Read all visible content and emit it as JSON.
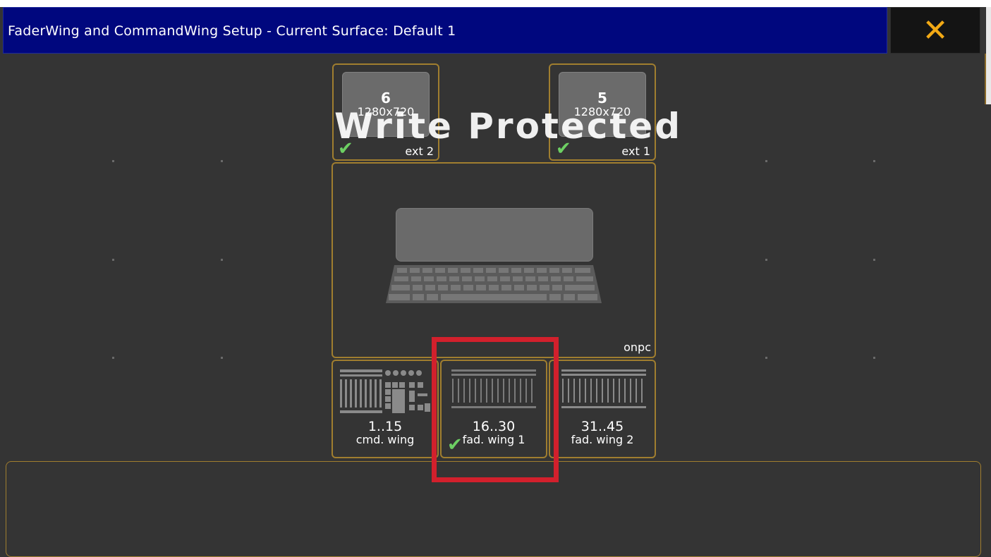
{
  "window": {
    "title": "FaderWing and CommandWing Setup - Current Surface: Default 1",
    "close_glyph": "✕"
  },
  "overlay": {
    "text": "Write Protected"
  },
  "monitors": [
    {
      "number": "6",
      "resolution": "1280x720",
      "name": "ext 2",
      "checked": true
    },
    {
      "number": "5",
      "resolution": "1280x720",
      "name": "ext 1",
      "checked": true
    }
  ],
  "console": {
    "name": "onpc",
    "icon": "laptop-icon"
  },
  "wings": [
    {
      "range": "1..15",
      "name": "cmd. wing",
      "checked": false,
      "icon": "command-wing-icon"
    },
    {
      "range": "16..30",
      "name": "fad. wing 1",
      "checked": true,
      "icon": "fader-wing-icon"
    },
    {
      "range": "31..45",
      "name": "fad. wing 2",
      "checked": false,
      "icon": "fader-wing-icon"
    }
  ],
  "colors": {
    "title_bar": "#00077e",
    "background": "#343434",
    "tile_border": "#a07e2f",
    "close_icon": "#f2a915",
    "check": "#6dd063",
    "highlight": "#d2202c"
  }
}
